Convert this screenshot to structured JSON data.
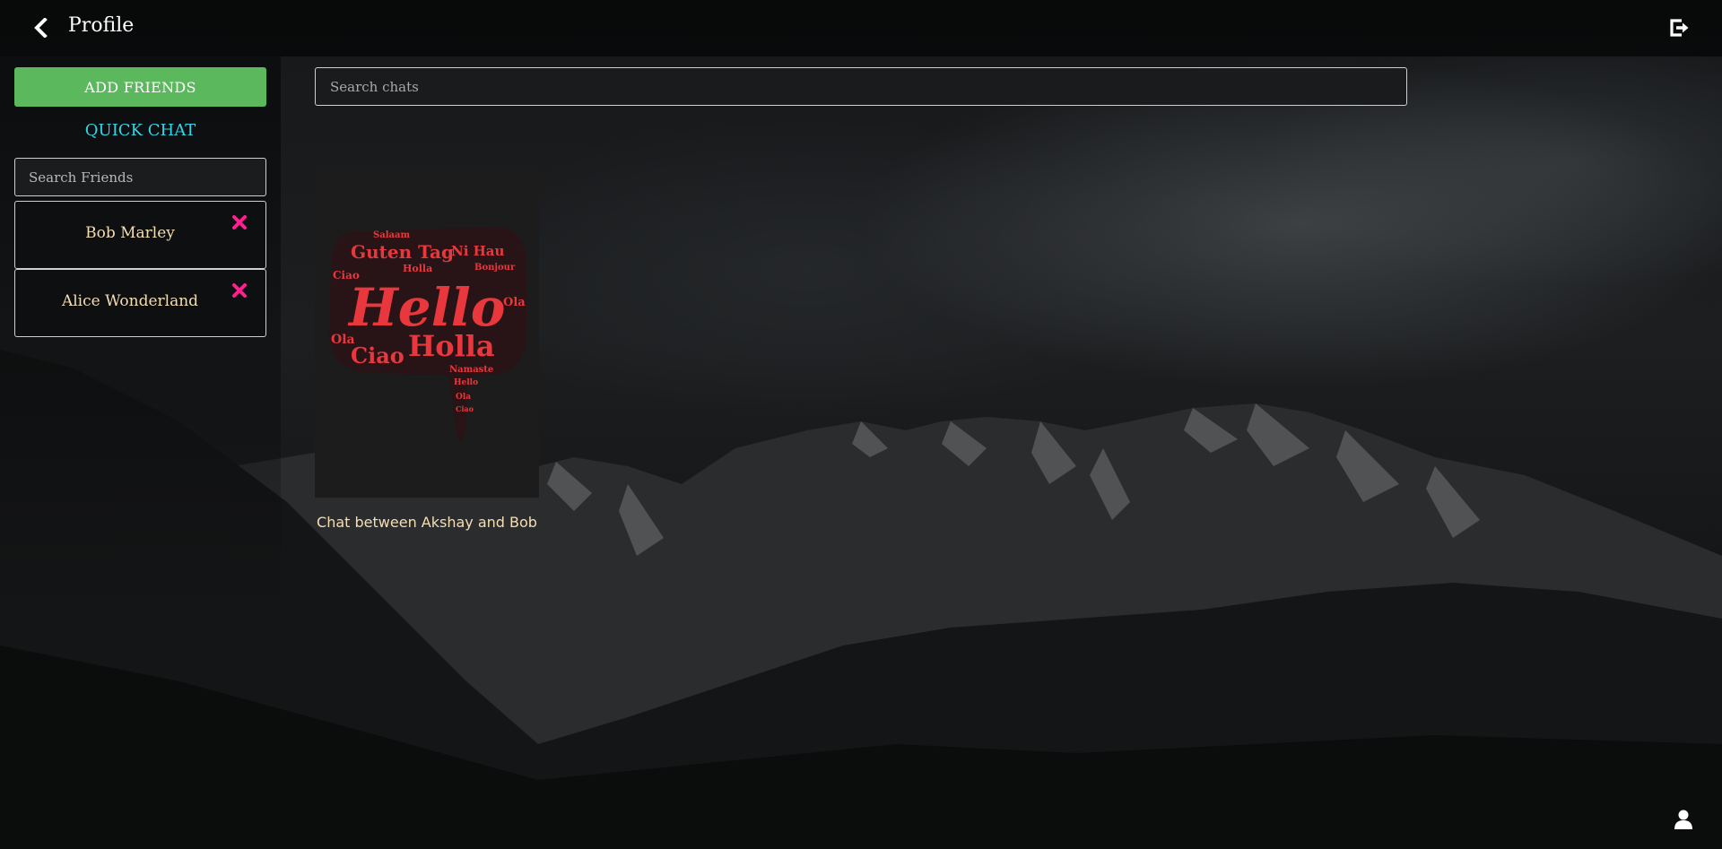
{
  "header": {
    "title": "Profile",
    "back_icon": "chevron-left-icon",
    "logout_icon": "sign-out-icon"
  },
  "sidebar": {
    "add_friends_label": "ADD FRIENDS",
    "quick_chat_label": "QUICK CHAT",
    "search_placeholder": "Search Friends",
    "friends": [
      {
        "name": "Bob Marley",
        "remove_icon": "close-x-icon"
      },
      {
        "name": "Alice Wonderland",
        "remove_icon": "close-x-icon"
      }
    ]
  },
  "main": {
    "search_placeholder": "Search chats",
    "chats": [
      {
        "caption": "Chat between Akshay and Bob",
        "thumbnail_icon": "hello-speech-bubble-word-cloud",
        "thumbnail_words": [
          "Hello",
          "Holla",
          "Ciao",
          "Guten Tag",
          "Ni Hau",
          "Ola",
          "Salaam",
          "Bonjour",
          "Namaste"
        ]
      }
    ]
  },
  "footer": {
    "profile_icon": "user-icon"
  },
  "colors": {
    "add_friends_bg": "#5cb85c",
    "quick_chat": "#34d6e6",
    "friend_name": "#f5deb3",
    "remove_icon": "#ff1f8e",
    "thumbnail_words": "#e8383d"
  }
}
